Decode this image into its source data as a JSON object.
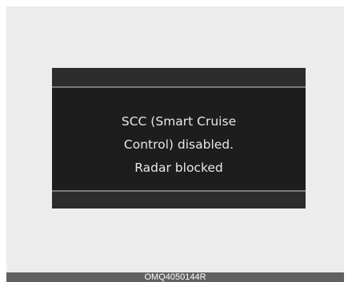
{
  "display": {
    "message_lines": [
      "SCC (Smart Cruise",
      "Control) disabled.",
      "Radar blocked"
    ]
  },
  "caption": "OMQ4050144R",
  "colors": {
    "background": "#ececec",
    "display_bg": "#1d1d1d",
    "display_bar": "#2c2c2c",
    "divider": "#7a7a7a",
    "text": "#e8e8e8",
    "caption_bar": "#616161"
  }
}
